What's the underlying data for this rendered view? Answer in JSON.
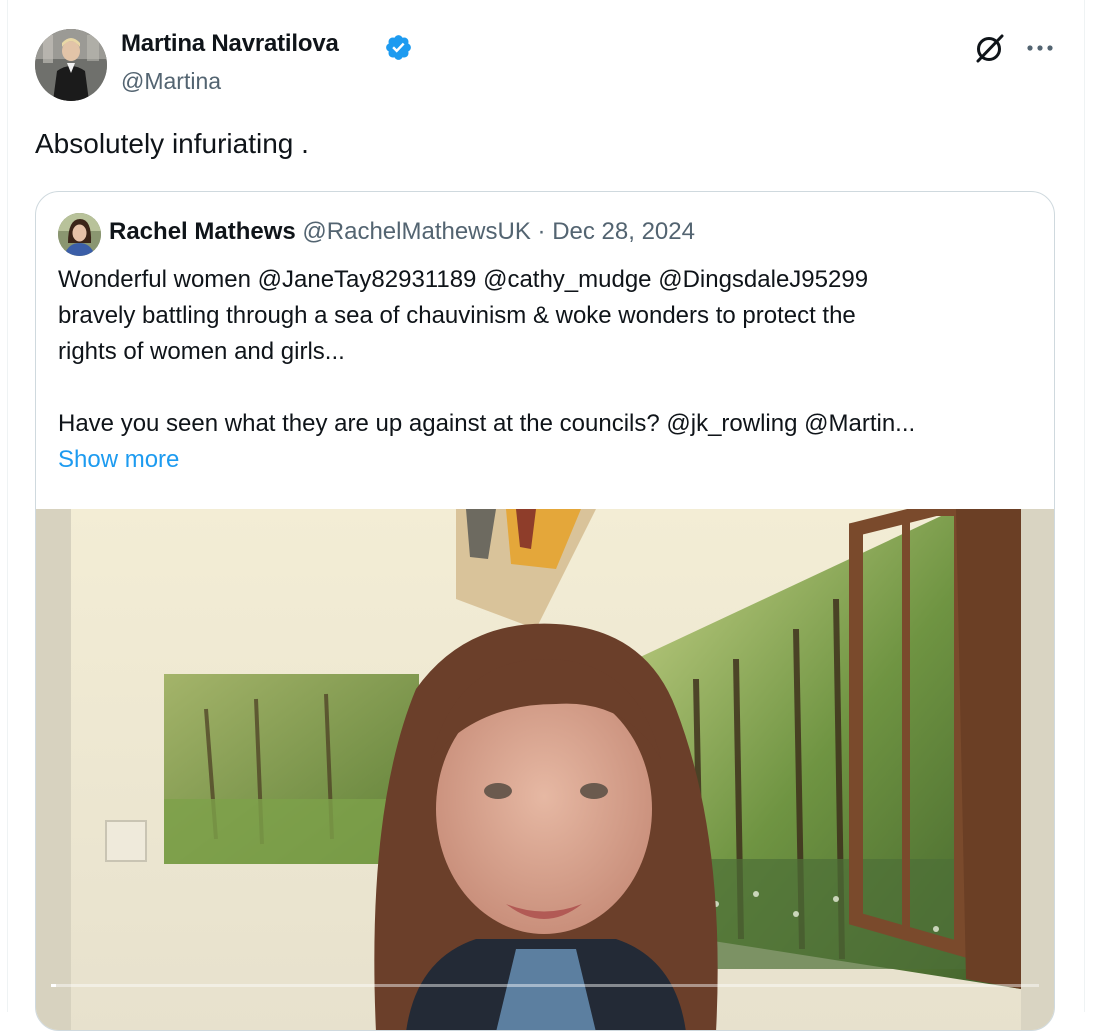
{
  "tweet": {
    "author_name": "Martina Navratilova",
    "author_handle": "@Martina",
    "verified": true,
    "text": "Absolutely infuriating .",
    "icons": [
      "grok-icon",
      "more-icon"
    ]
  },
  "quote": {
    "author_name": "Rachel Mathews",
    "author_handle": "@RachelMathewsUK",
    "separator": "·",
    "date": "Dec 28, 2024",
    "lines": [
      "Wonderful women @JaneTay82931189 @cathy_mudge @DingsdaleJ95299",
      "bravely battling through a sea of chauvinism & woke wonders to protect the",
      "rights of women and girls...",
      "Have you seen what they are up against at the councils? @jk_rowling @Martin..."
    ],
    "show_more": "Show more"
  },
  "video": {
    "progress": 0.005
  },
  "colors": {
    "accent": "#1d9bf0",
    "text": "#0f1419",
    "secondary": "#536471",
    "border": "#cfd9de"
  }
}
